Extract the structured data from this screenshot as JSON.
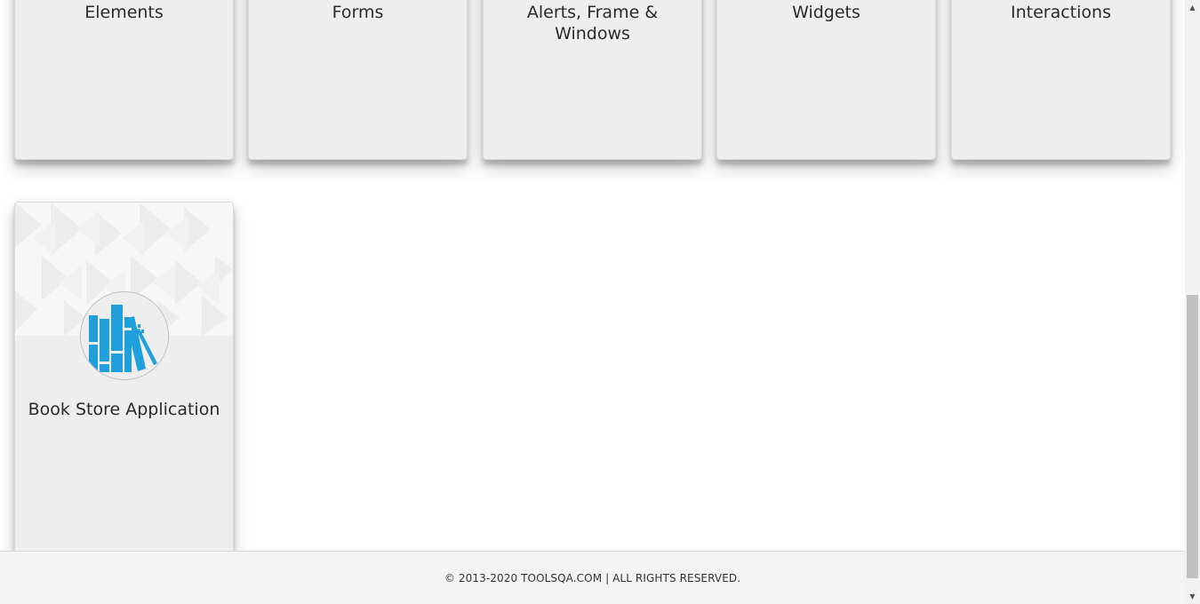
{
  "cards": [
    {
      "title": "Elements"
    },
    {
      "title": "Forms"
    },
    {
      "title": "Alerts, Frame & Windows"
    },
    {
      "title": "Widgets"
    },
    {
      "title": "Interactions"
    },
    {
      "title": "Book Store Application",
      "icon": "book-store-icon"
    }
  ],
  "footer": {
    "copyright": "© 2013-2020 TOOLSQA.COM | ALL RIGHTS RESERVED."
  },
  "colors": {
    "card_background": "#eeeeee",
    "icon_blue": "#1fa0dc",
    "footer_background": "#f4f4f4"
  }
}
